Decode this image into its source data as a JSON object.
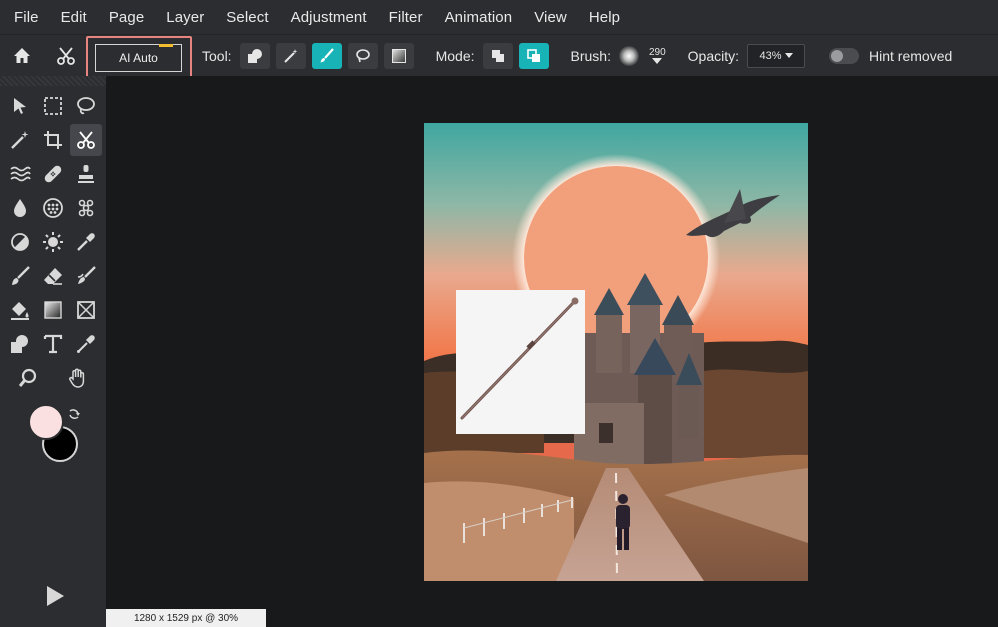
{
  "menu": [
    "File",
    "Edit",
    "Page",
    "Layer",
    "Select",
    "Adjustment",
    "Filter",
    "Animation",
    "View",
    "Help"
  ],
  "options": {
    "ai_auto_label": "AI Auto",
    "tool_label": "Tool:",
    "mode_label": "Mode:",
    "brush_label": "Brush:",
    "brush_size": "290",
    "opacity_label": "Opacity:",
    "opacity_value": "43%",
    "hint_label": "Hint removed"
  },
  "status": {
    "text": "1280 x 1529 px @ 30%"
  },
  "colors": {
    "accent": "#18b3b6",
    "highlight": "#e8847f",
    "foreground": "#fae0e0",
    "background": "#000000"
  },
  "tools": [
    "select-arrow-icon",
    "marquee-icon",
    "lasso-icon",
    "magic-wand-icon",
    "crop-icon",
    "scissors-icon",
    "liquify-icon",
    "heal-icon",
    "stamp-icon",
    "blur-drop-icon",
    "sponge-icon",
    "dots-icon",
    "dodge-icon",
    "sun-icon",
    "dropper-icon",
    "brush-icon",
    "eraser-icon",
    "smudge-icon",
    "fill-bucket-icon",
    "gradient-icon",
    "transform-icon",
    "shape-icon",
    "text-icon",
    "eyedropper-icon",
    "zoom-icon",
    "hand-icon"
  ]
}
